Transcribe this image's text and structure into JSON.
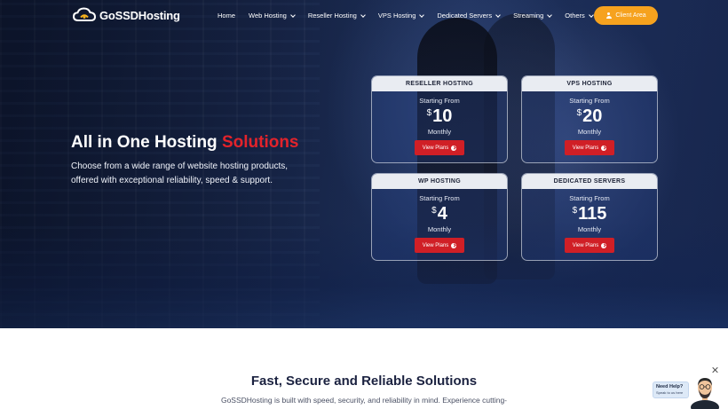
{
  "header": {
    "logo_text": "GoSSDHosting",
    "nav": [
      {
        "label": "Home",
        "dropdown": false
      },
      {
        "label": "Web Hosting",
        "dropdown": true
      },
      {
        "label": "Reseller Hosting",
        "dropdown": true
      },
      {
        "label": "VPS Hosting",
        "dropdown": true
      },
      {
        "label": "Dedicated Servers",
        "dropdown": true
      },
      {
        "label": "Streaming",
        "dropdown": true
      },
      {
        "label": "Others",
        "dropdown": true
      }
    ],
    "client_area_label": "Client Area"
  },
  "hero": {
    "title_main": "All in One Hosting",
    "title_accent": "Solutions",
    "subtitle": "Choose from a wide range of website hosting products, offered with exceptional reliability, speed & support."
  },
  "plans": [
    {
      "name": "RESELLER HOSTING",
      "starting": "Starting From",
      "currency": "$",
      "price": "10",
      "period": "Monthly",
      "button": "View Plans"
    },
    {
      "name": "VPS HOSTING",
      "starting": "Starting From",
      "currency": "$",
      "price": "20",
      "period": "Monthly",
      "button": "View Plans"
    },
    {
      "name": "WP HOSTING",
      "starting": "Starting From",
      "currency": "$",
      "price": "4",
      "period": "Monthly",
      "button": "View Plans"
    },
    {
      "name": "DEDICATED SERVERS",
      "starting": "Starting From",
      "currency": "$",
      "price": "115",
      "period": "Monthly",
      "button": "View Plans"
    }
  ],
  "section": {
    "title": "Fast, Secure and Reliable Solutions",
    "text": "GoSSDHosting is built with speed, security, and reliability in mind. Experience cutting-"
  },
  "help_widget": {
    "title": "Need Help?",
    "subtitle": "Speak to us here"
  },
  "colors": {
    "accent_red": "#d01f26",
    "client_button": "#f6a21e",
    "title_accent": "#e3232b"
  },
  "icons": [
    "logo-cloud-icon",
    "chevron-down-icon",
    "user-icon",
    "arrow-circle-right-icon",
    "close-icon",
    "support-avatar"
  ]
}
